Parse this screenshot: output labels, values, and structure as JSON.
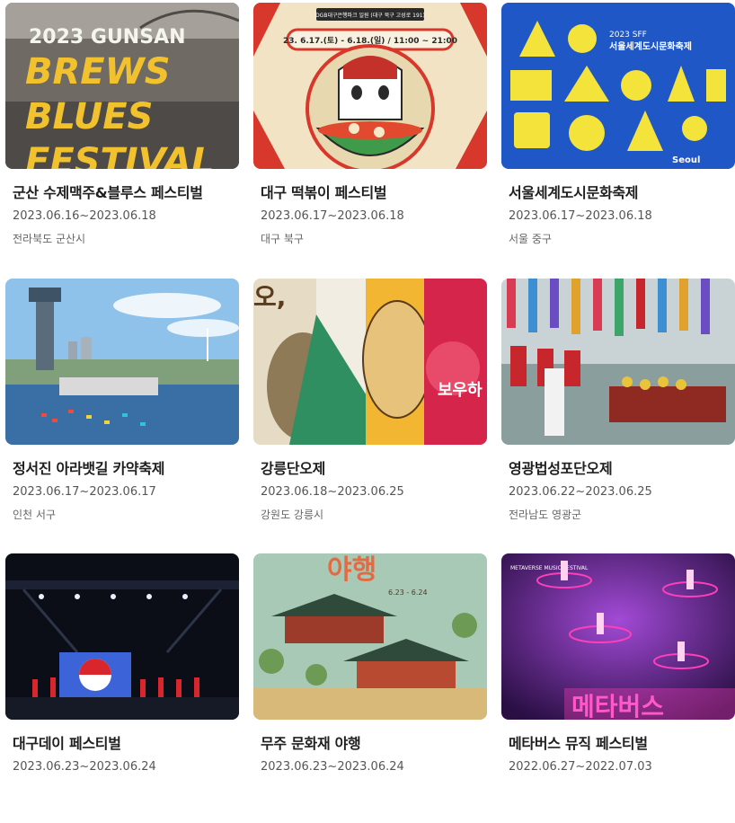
{
  "festivals": [
    {
      "title": "군산 수제맥주&블루스 페스티벌",
      "date": "2023.06.16~2023.06.18",
      "location": "전라북도 군산시",
      "poster_text": [
        "2023 GUNSAN",
        "BREWS",
        "BLUES",
        "FESTIVAL"
      ],
      "colors": {
        "bg": "#6f6a63",
        "accent": "#f2c12e"
      }
    },
    {
      "title": "대구 떡볶이 페스티벌",
      "date": "2023.06.17~2023.06.18",
      "location": "대구 북구",
      "poster_text": [
        "DGB대구은행파크 일원 (대구 북구 고성로 191)",
        "23. 6.17.(토) - 6.18.(일) / 11:00 ~ 21:00"
      ],
      "colors": {
        "bg": "#f1e3c4",
        "accent": "#d8382b"
      }
    },
    {
      "title": "서울세계도시문화축제",
      "date": "2023.06.17~2023.06.18",
      "location": "서울 중구",
      "poster_text": [
        "2023 SFF",
        "서울세계도시문화축제",
        "Seoul"
      ],
      "colors": {
        "bg": "#1f57c7",
        "accent": "#f3e33a"
      }
    },
    {
      "title": "정서진 아라뱃길 카약축제",
      "date": "2023.06.17~2023.06.17",
      "location": "인천 서구",
      "poster_text": [],
      "colors": {
        "bg": "#8fc2ea",
        "accent": "#2e7bd6"
      }
    },
    {
      "title": "강릉단오제",
      "date": "2023.06.18~2023.06.25",
      "location": "강원도 강릉시",
      "poster_text": [
        "오,",
        "보우하"
      ],
      "colors": {
        "bg": "#f1ede3",
        "accent": "#e0324b"
      }
    },
    {
      "title": "영광법성포단오제",
      "date": "2023.06.22~2023.06.25",
      "location": "전라남도 영광군",
      "poster_text": [],
      "colors": {
        "bg": "#c9d3d6",
        "accent": "#c7262d"
      }
    },
    {
      "title": "대구데이 페스티벌",
      "date": "2023.06.23~2023.06.24",
      "location": "",
      "poster_text": [],
      "colors": {
        "bg": "#0b0d17",
        "accent": "#3d63d9"
      }
    },
    {
      "title": "무주 문화재 야행",
      "date": "2023.06.23~2023.06.24",
      "location": "",
      "poster_text": [
        "야행",
        "6.23 - 6.24"
      ],
      "colors": {
        "bg": "#a9c9b7",
        "accent": "#e36b43"
      }
    },
    {
      "title": "메타버스 뮤직 페스티벌",
      "date": "2022.06.27~2022.07.03",
      "location": "",
      "poster_text": [
        "METAVERSE MUSIC FESTIVAL",
        "메타버스"
      ],
      "colors": {
        "bg": "#4a1d6b",
        "accent": "#ff3fb8"
      }
    }
  ]
}
